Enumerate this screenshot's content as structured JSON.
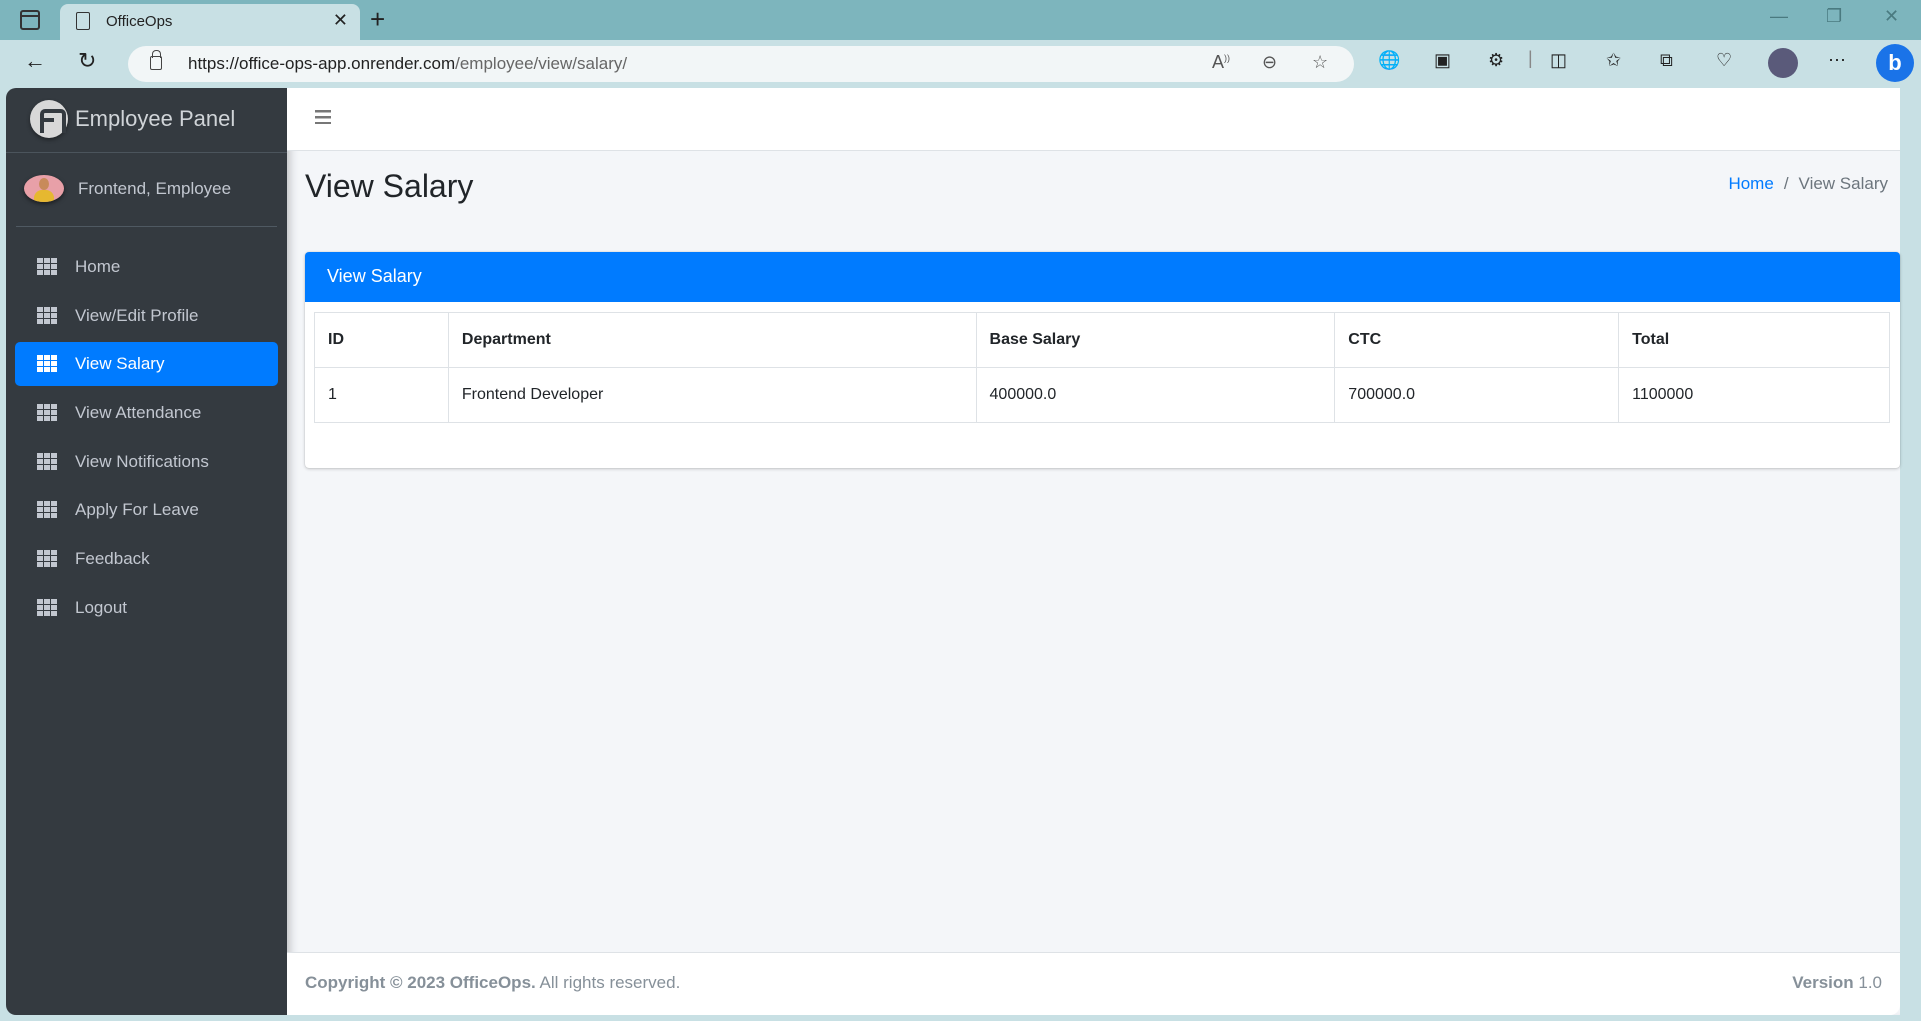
{
  "browser": {
    "tab_title": "OfficeOps",
    "url_host": "https://office-ops-app.onrender.com",
    "url_path": "/employee/view/salary/",
    "icons": [
      "sidebar-toggle-icon",
      "page-icon",
      "close-icon",
      "new-tab-icon",
      "back-icon",
      "refresh-icon",
      "lock-icon",
      "read-aloud-icon",
      "zoom-out-icon",
      "favorite-icon",
      "extension-globe-icon",
      "picture-in-picture-icon",
      "extensions-icon",
      "split-screen-icon",
      "favorites-icon",
      "collections-icon",
      "browser-essentials-icon",
      "profile-avatar",
      "more-icon",
      "bing-icon"
    ]
  },
  "sidebar": {
    "brand": "Employee Panel",
    "user_name": "Frontend, Employee",
    "items": [
      {
        "label": "Home",
        "active": false
      },
      {
        "label": "View/Edit Profile",
        "active": false
      },
      {
        "label": "View Salary",
        "active": true
      },
      {
        "label": "View Attendance",
        "active": false
      },
      {
        "label": "View Notifications",
        "active": false
      },
      {
        "label": "Apply For Leave",
        "active": false
      },
      {
        "label": "Feedback",
        "active": false
      },
      {
        "label": "Logout",
        "active": false
      }
    ]
  },
  "header": {
    "title": "View Salary",
    "breadcrumb": {
      "home": "Home",
      "separator": "/",
      "current": "View Salary"
    }
  },
  "card": {
    "title": "View Salary",
    "columns": [
      "ID",
      "Department",
      "Base Salary",
      "CTC",
      "Total"
    ],
    "rows": [
      [
        "1",
        "Frontend Developer",
        "400000.0",
        "700000.0",
        "1100000"
      ]
    ]
  },
  "footer": {
    "copyright_bold": "Copyright © 2023 OfficeOps.",
    "copyright_rest": " All rights reserved.",
    "version_label": "Version",
    "version_value": " 1.0"
  },
  "colors": {
    "primary": "#007bff",
    "sidebar_bg": "#343a40",
    "content_bg": "#f4f6f9"
  }
}
